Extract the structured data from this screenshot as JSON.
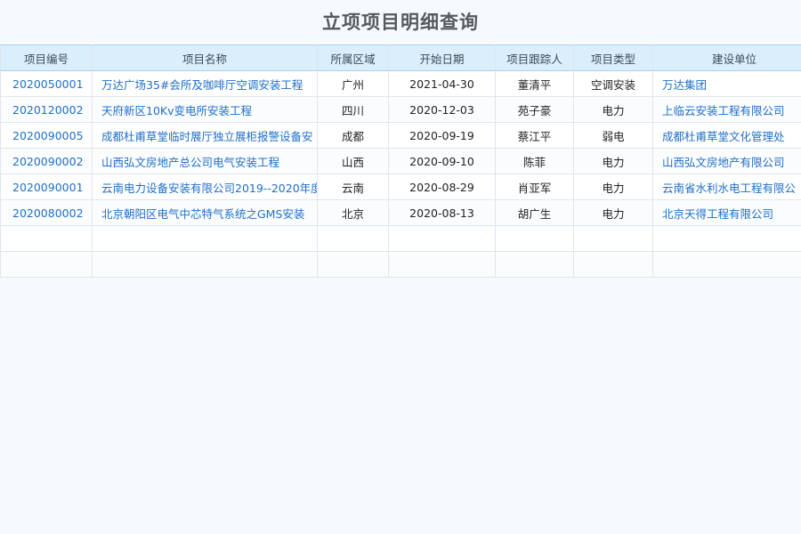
{
  "page": {
    "title": "立项项目明细查询"
  },
  "table": {
    "headers": [
      "项目编号",
      "项目名称",
      "所属区域",
      "开始日期",
      "项目跟踪人",
      "项目类型",
      "建设单位"
    ],
    "rows": [
      {
        "code": "2020050001",
        "name": "万达广场35#会所及咖啡厅空调安装工程",
        "region": "广州",
        "start": "2021-04-30",
        "tracker": "董清平",
        "type": "空调安装",
        "unit": "万达集团"
      },
      {
        "code": "2020120002",
        "name": "天府新区10Kv变电所安装工程",
        "region": "四川",
        "start": "2020-12-03",
        "tracker": "苑子豪",
        "type": "电力",
        "unit": "上临云安装工程有限公司"
      },
      {
        "code": "2020090005",
        "name": "成都杜甫草堂临时展厅独立展柜报警设备安",
        "region": "成都",
        "start": "2020-09-19",
        "tracker": "蔡江平",
        "type": "弱电",
        "unit": "成都杜甫草堂文化管理处"
      },
      {
        "code": "2020090002",
        "name": "山西弘文房地产总公司电气安装工程",
        "region": "山西",
        "start": "2020-09-10",
        "tracker": "陈菲",
        "type": "电力",
        "unit": "山西弘文房地产有限公司"
      },
      {
        "code": "2020090001",
        "name": "云南电力设备安装有限公司2019--2020年度",
        "region": "云南",
        "start": "2020-08-29",
        "tracker": "肖亚军",
        "type": "电力",
        "unit": "云南省水利水电工程有限公"
      },
      {
        "code": "2020080002",
        "name": "北京朝阳区电气中芯特气系统之GMS安装",
        "region": "北京",
        "start": "2020-08-13",
        "tracker": "胡广生",
        "type": "电力",
        "unit": "北京天得工程有限公司"
      }
    ],
    "empty_rows": 2
  }
}
